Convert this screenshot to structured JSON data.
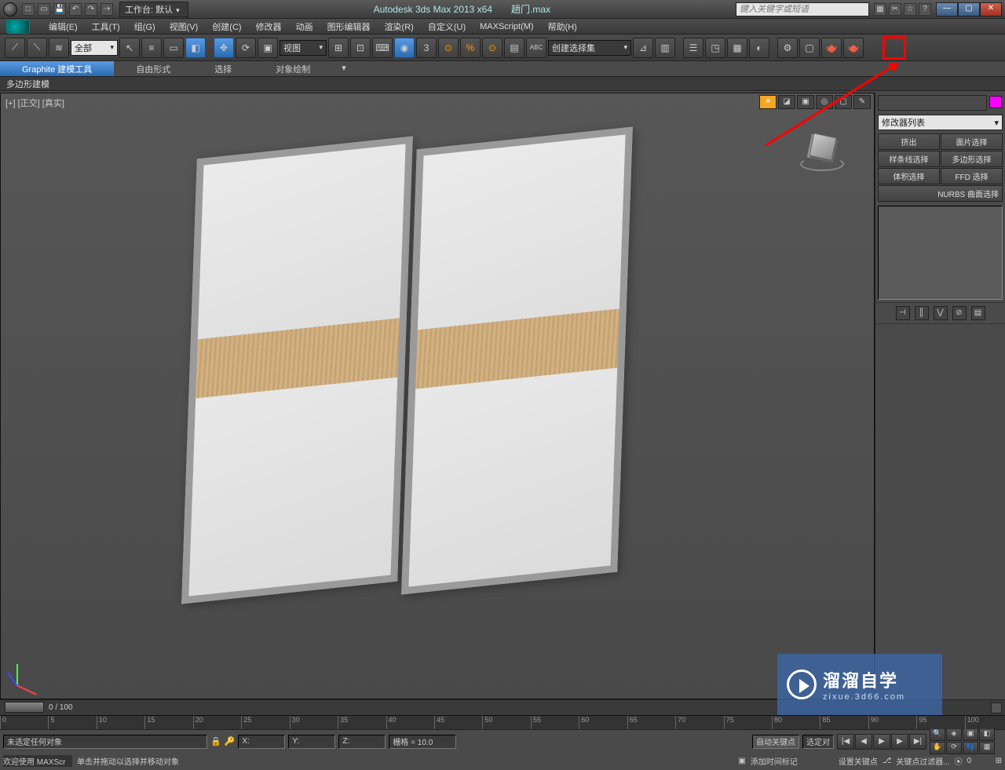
{
  "title": {
    "app": "Autodesk 3ds Max  2013 x64",
    "file": "趟门.max",
    "workspace_label": "工作台: 默认",
    "search_placeholder": "键入关键字或短语"
  },
  "menu": {
    "items": [
      "编辑(E)",
      "工具(T)",
      "组(G)",
      "视图(V)",
      "创建(C)",
      "修改器",
      "动画",
      "图形编辑器",
      "渲染(R)",
      "自定义(U)",
      "MAXScript(M)",
      "帮助(H)"
    ]
  },
  "toolbar": {
    "filter_label": "全部",
    "view_label": "视图",
    "selset_label": "创建选择集"
  },
  "ribbon": {
    "tabs": [
      "Graphite 建模工具",
      "自由形式",
      "选择",
      "对象绘制"
    ],
    "sub": "多边形建模"
  },
  "viewport": {
    "label": "[+] [正交] [真实]"
  },
  "panel": {
    "modifier_list": "修改器列表",
    "buttons": [
      "挤出",
      "面片选择",
      "样条线选择",
      "多边形选择",
      "体积选择",
      "FFD 选择"
    ],
    "nurbs": "NURBS 曲面选择"
  },
  "timeline": {
    "range": "0 / 100",
    "ticks": [
      "0",
      "5",
      "10",
      "15",
      "20",
      "25",
      "30",
      "35",
      "40",
      "45",
      "50",
      "55",
      "60",
      "65",
      "70",
      "75",
      "80",
      "85",
      "90",
      "95",
      "100"
    ]
  },
  "status": {
    "selection": "未选定任何对象",
    "hint": "单击并拖动以选择并移动对象",
    "welcome": "欢迎使用 MAXScr",
    "grid": "栅格 = 10.0",
    "x": "X:",
    "y": "Y:",
    "z": "Z:",
    "autokey": "自动关键点",
    "setkey": "设置关键点",
    "selkey": "选定对",
    "keyfilter": "关键点过滤器...",
    "addtime": "添加时间标记",
    "frame": "0"
  },
  "watermark": {
    "big": "溜溜自学",
    "small": "zixue.3d66.com"
  }
}
